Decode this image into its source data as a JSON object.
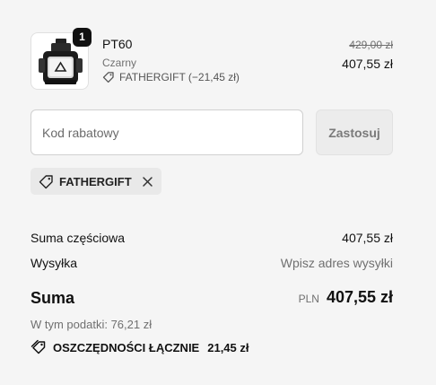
{
  "product": {
    "quantity": "1",
    "name": "PT60",
    "variant": "Czarny",
    "discount_label": "FATHERGIFT (−21,45 zł)",
    "original_price": "429,00 zł",
    "final_price": "407,55 zł",
    "image_icon": "vacuum-sealer-device-image"
  },
  "discount": {
    "placeholder": "Kod rabatowy",
    "apply_label": "Zastosuj",
    "applied_code": "FATHERGIFT"
  },
  "summary": {
    "subtotal_label": "Suma częściowa",
    "subtotal_value": "407,55 zł",
    "shipping_label": "Wysyłka",
    "shipping_value": "Wpisz adres wysyłki",
    "total_label": "Suma",
    "currency": "PLN",
    "total_value": "407,55 zł",
    "taxes_text": "W tym podatki: 76,21 zł",
    "savings_label": "OSZCZĘDNOŚCI ŁĄCZNIE",
    "savings_value": "21,45 zł"
  },
  "colors": {
    "background": "#f5f5f5",
    "text": "#111111",
    "muted": "#707070",
    "badge": "#111111"
  }
}
